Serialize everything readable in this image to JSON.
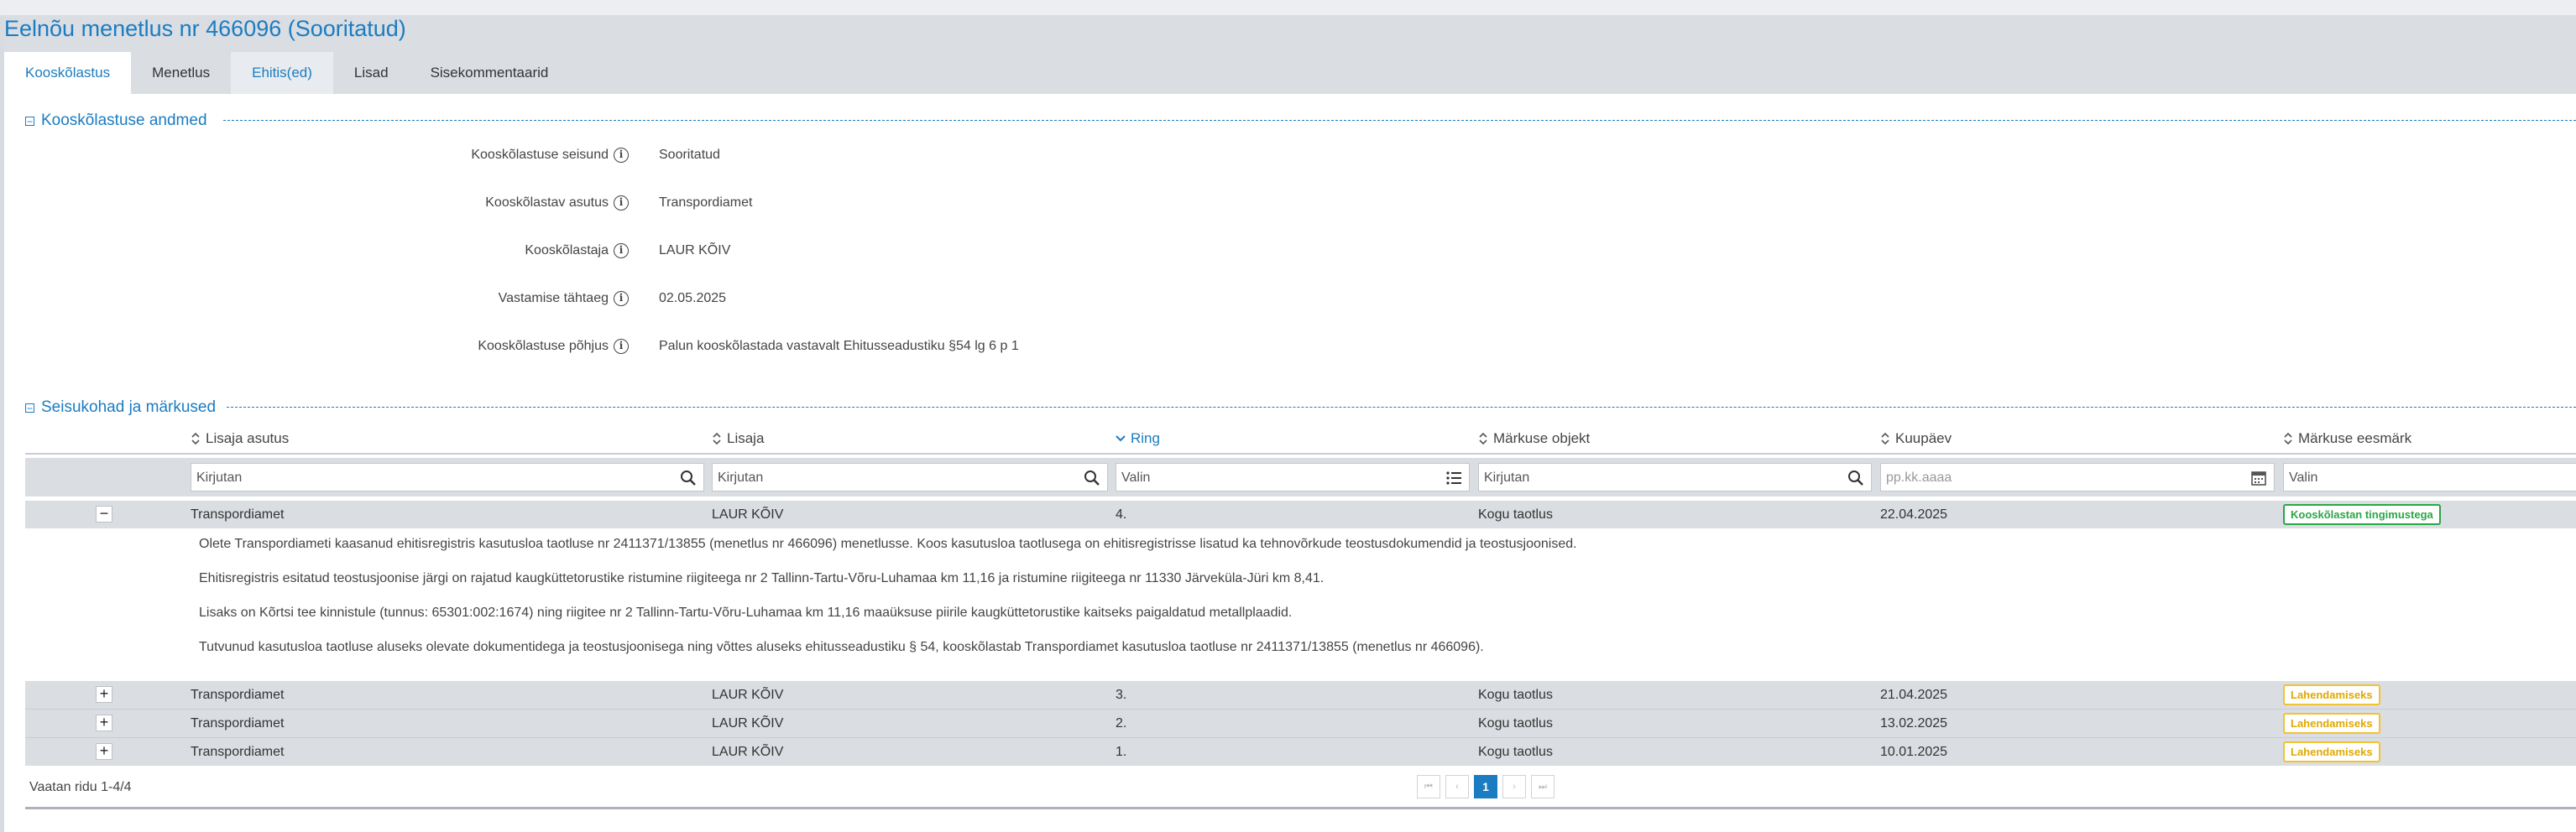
{
  "title": "Eelnõu menetlus nr 466096 (Sooritatud)",
  "tabs": [
    {
      "label": "Kooskõlastus"
    },
    {
      "label": "Menetlus"
    },
    {
      "label": "Ehitis(ed)"
    },
    {
      "label": "Lisad"
    },
    {
      "label": "Sisekommentaarid"
    }
  ],
  "section1": {
    "title": "Kooskõlastuse andmed",
    "toggle": "−",
    "fields": [
      {
        "label": "Kooskõlastuse seisund",
        "value": "Sooritatud"
      },
      {
        "label": "Kooskõlastav asutus",
        "value": "Transpordiamet"
      },
      {
        "label": "Kooskõlastaja",
        "value": "LAUR KÕIV"
      },
      {
        "label": "Vastamise tähtaeg",
        "value": "02.05.2025"
      },
      {
        "label": "Kooskõlastuse põhjus",
        "value": "Palun kooskõlastada vastavalt Ehitusseadustiku §54 lg 6 p 1"
      }
    ]
  },
  "section2": {
    "title": "Seisukohad ja märkused",
    "toggle": "−"
  },
  "grid": {
    "columns": [
      {
        "label": "Lisaja asutus"
      },
      {
        "label": "Lisaja"
      },
      {
        "label": "Ring"
      },
      {
        "label": "Märkuse objekt"
      },
      {
        "label": "Kuupäev"
      },
      {
        "label": "Märkuse eesmärk"
      }
    ],
    "filters": {
      "asutus": "Kirjutan",
      "lisaja": "Kirjutan",
      "ring": "Valin",
      "objekt": "Kirjutan",
      "kuupaev": "pp.kk.aaaa",
      "eesmark": "Valin"
    },
    "rows": [
      {
        "toggle": "−",
        "asutus": "Transpordiamet",
        "lisaja": "LAUR KÕIV",
        "ring": "4.",
        "objekt": "Kogu taotlus",
        "kuupaev": "22.04.2025",
        "eesmark": "Kooskõlastan tingimustega"
      },
      {
        "toggle": "+",
        "asutus": "Transpordiamet",
        "lisaja": "LAUR KÕIV",
        "ring": "3.",
        "objekt": "Kogu taotlus",
        "kuupaev": "21.04.2025",
        "eesmark": "Lahendamiseks"
      },
      {
        "toggle": "+",
        "asutus": "Transpordiamet",
        "lisaja": "LAUR KÕIV",
        "ring": "2.",
        "objekt": "Kogu taotlus",
        "kuupaev": "13.02.2025",
        "eesmark": "Lahendamiseks"
      },
      {
        "toggle": "+",
        "asutus": "Transpordiamet",
        "lisaja": "LAUR KÕIV",
        "ring": "1.",
        "objekt": "Kogu taotlus",
        "kuupaev": "10.01.2025",
        "eesmark": "Lahendamiseks"
      }
    ],
    "detail": [
      "Olete Transpordiameti kaasanud ehitisregistris kasutusloa taotluse nr 2411371/13855 (menetlus nr 466096) menetlusse. Koos kasutusloa taotlusega on ehitisregistrisse lisatud ka tehnovõrkude teostusdokumendid ja teostusjoonised.",
      "Ehitisregistris esitatud teostusjoonise järgi on rajatud kaugküttetorustike ristumine riigiteega nr 2 Tallinn-Tartu-Võru-Luhamaa km 11,16 ja ristumine riigiteega nr 11330 Järveküla-Jüri km 8,41.",
      "Lisaks on Kõrtsi tee kinnistule (tunnus: 65301:002:1674) ning riigitee nr 2 Tallinn-Tartu-Võru-Luhamaa km 11,16 maaüksuse piirile kaugküttetorustike kaitseks paigaldatud metallplaadid.",
      "Tutvunud kasutusloa taotluse aluseks olevate dokumentidega ja teostusjoonisega ning võttes aluseks ehitusseadustiku § 54, kooskõlastab Transpordiamet kasutusloa taotluse nr 2411371/13855 (menetlus nr 466096)."
    ]
  },
  "footer": {
    "info": "Vaatan ridu 1-4/4",
    "pager": {
      "first": "⏮",
      "prev": "‹",
      "current": "1",
      "next": "›",
      "last": "⏭"
    }
  },
  "icons": {
    "info": "info-icon",
    "search": "search-icon",
    "list": "list-icon",
    "calendar": "calendar-icon",
    "sort": "sort-icon",
    "sorted": "chevron-down-icon"
  },
  "colors": {
    "accent": "#1b7cc1",
    "status_green": "#29a745",
    "status_yellow": "#f2c230"
  }
}
